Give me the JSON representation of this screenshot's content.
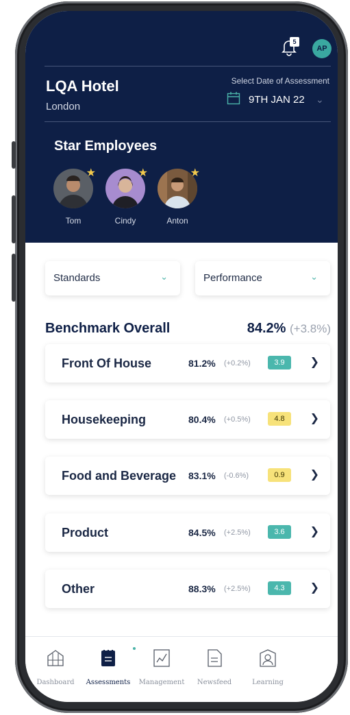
{
  "header": {
    "notifications_count": "5",
    "user_initials": "AP",
    "hotel_name": "LQA Hotel",
    "hotel_city": "London",
    "date_label": "Select Date of Assessment",
    "date_value": "9TH JAN 22"
  },
  "star_employees": {
    "title": "Star Employees",
    "people": [
      {
        "name": "Tom"
      },
      {
        "name": "Cindy"
      },
      {
        "name": "Anton"
      }
    ]
  },
  "filters": {
    "left": "Standards",
    "right": "Performance"
  },
  "benchmark": {
    "label": "Benchmark Overall",
    "value": "84.2%",
    "change": "(+3.8%)"
  },
  "categories": [
    {
      "name": "Front Of House",
      "pct": "81.2%",
      "change": "(+0.2%)",
      "score": "3.9",
      "score_color": "#4bb7ad"
    },
    {
      "name": "Housekeeping",
      "pct": "80.4%",
      "change": "(+0.5%)",
      "score": "4.8",
      "score_color": "#f7e27a"
    },
    {
      "name": "Food and Beverage",
      "pct": "83.1%",
      "change": "(-0.6%)",
      "score": "0.9",
      "score_color": "#f7e27a"
    },
    {
      "name": "Product",
      "pct": "84.5%",
      "change": "(+2.5%)",
      "score": "3.6",
      "score_color": "#4bb7ad"
    },
    {
      "name": "Other",
      "pct": "88.3%",
      "change": "(+2.5%)",
      "score": "4.3",
      "score_color": "#4bb7ad"
    }
  ],
  "nav": {
    "items": [
      {
        "label": "Dashboard",
        "icon": "building-icon"
      },
      {
        "label": "Assessments",
        "icon": "clipboard-icon",
        "active": true
      },
      {
        "label": "Management",
        "icon": "chart-icon"
      },
      {
        "label": "Newsfeed",
        "icon": "document-icon"
      },
      {
        "label": "Learning",
        "icon": "user-icon"
      }
    ]
  },
  "colors": {
    "header_bg": "#0e1f46",
    "accent": "#4ab3a8"
  }
}
